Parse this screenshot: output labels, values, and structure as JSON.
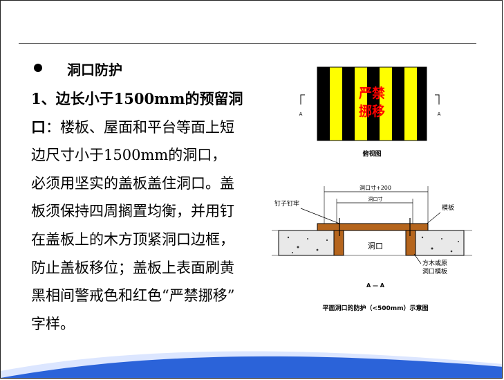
{
  "section": {
    "title": "洞口防护",
    "subtitle": "1、边长小于1500mm的预留洞"
  },
  "body_lines": [
    "口：楼板、屋面和平台等面上短",
    "边尺寸小于1500mm的洞口，",
    "必须用坚实的盖板盖住洞口。盖",
    "板须保持四周搁置均衡，并用钉",
    "在盖板上的木方顶紧洞口边框，",
    "防止盖板移位；盖板上表面刷黄",
    "黑相间警戒色和红色“严禁挪移”",
    "字样。"
  ],
  "body_first_bold": "口",
  "body_first_rest": "：楼板、屋面和平台等面上短",
  "figure": {
    "plan_sign_line1": "严禁",
    "plan_sign_line2": "挪移",
    "section_marker": "A",
    "plan_caption": "俯视图",
    "dim_outer": "洞口寸+200",
    "dim_inner": "洞口寸",
    "nail_label": "钉子钉牢",
    "board_label": "模板",
    "hole_label": "洞口",
    "frame_label_line1": "方木或原",
    "frame_label_line2": "洞口模板",
    "section_caption": "A — A",
    "main_caption": "平面洞口的防护（<500mm）示意图",
    "colors": {
      "stripe_yellow": "#ffff00",
      "stripe_black": "#000000",
      "warning_red": "#ff0000",
      "board_brown": "#b5651d",
      "concrete": "#e9e9e9"
    }
  },
  "theme": {
    "wave_blue": "#2b63d9",
    "wave_light": "#dce6ff"
  }
}
